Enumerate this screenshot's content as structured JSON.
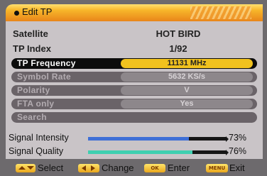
{
  "header": {
    "title": "Edit  TP"
  },
  "info": {
    "satellite_label": "Satellite",
    "satellite_value": "HOT BIRD",
    "tp_index_label": "TP Index",
    "tp_index_value": "1/92"
  },
  "rows": [
    {
      "label": "TP Frequency",
      "value": "11131 MHz"
    },
    {
      "label": "Symbol Rate",
      "value": "5632  KS/s"
    },
    {
      "label": "Polarity",
      "value": "V"
    },
    {
      "label": "FTA  only",
      "value": "Yes"
    },
    {
      "label": "Search"
    }
  ],
  "signal": {
    "intensity_label": "Signal Intensity",
    "intensity_percent": "73%",
    "intensity_value": 0.73,
    "quality_label": "Signal Quality",
    "quality_percent": "76%",
    "quality_value": 0.76,
    "colors": {
      "intensity": "#3f6fd6",
      "quality": "#3fcfb0"
    }
  },
  "footer": {
    "select_label": "Select",
    "change_label": "Change",
    "enter_label": "Enter",
    "exit_label": "Exit",
    "ok_key": "OK",
    "menu_key": "MENU"
  },
  "colors": {
    "selected_pill": "#f1c21e",
    "accent": "#e9851a"
  }
}
